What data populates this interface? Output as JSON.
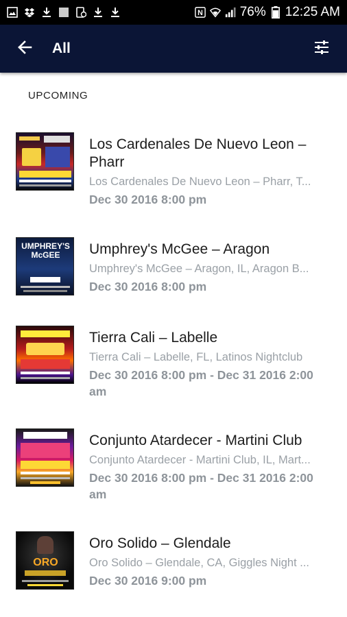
{
  "status_bar": {
    "battery": "76%",
    "time": "12:25 AM",
    "nfc": "N"
  },
  "app_bar": {
    "title": "All"
  },
  "section": {
    "header": "UPCOMING"
  },
  "events": [
    {
      "title": "Los Cardenales De Nuevo Leon – Pharr",
      "subtitle": "Los Cardenales De Nuevo Leon – Pharr, T...",
      "date": "Dec 30 2016 8:00 pm"
    },
    {
      "title": "Umphrey's McGee – Aragon",
      "subtitle": "Umphrey's McGee – Aragon, IL, Aragon B...",
      "date": "Dec 30 2016 8:00 pm",
      "poster_text": "UMPHREY'S McGEE"
    },
    {
      "title": "Tierra Cali – Labelle",
      "subtitle": "Tierra Cali – Labelle, FL, Latinos Nightclub",
      "date": "Dec 30 2016 8:00 pm - Dec 31 2016 2:00 am"
    },
    {
      "title": "Conjunto Atardecer - Martini Club",
      "subtitle": "Conjunto Atardecer - Martini Club, IL, Mart...",
      "date": "Dec 30 2016 8:00 pm - Dec 31 2016 2:00 am"
    },
    {
      "title": "Oro Solido – Glendale",
      "subtitle": "Oro Solido – Glendale, CA, Giggles Night ...",
      "date": "Dec 30 2016 9:00 pm",
      "poster_text": "ORO"
    }
  ],
  "icons": {
    "back": "arrow-left-icon",
    "filter": "tune-icon"
  },
  "colors": {
    "app_bar": "#0b1536",
    "status_bar": "#000000",
    "title_text": "#1c1c1c",
    "secondary_text": "#9aa0a6"
  }
}
